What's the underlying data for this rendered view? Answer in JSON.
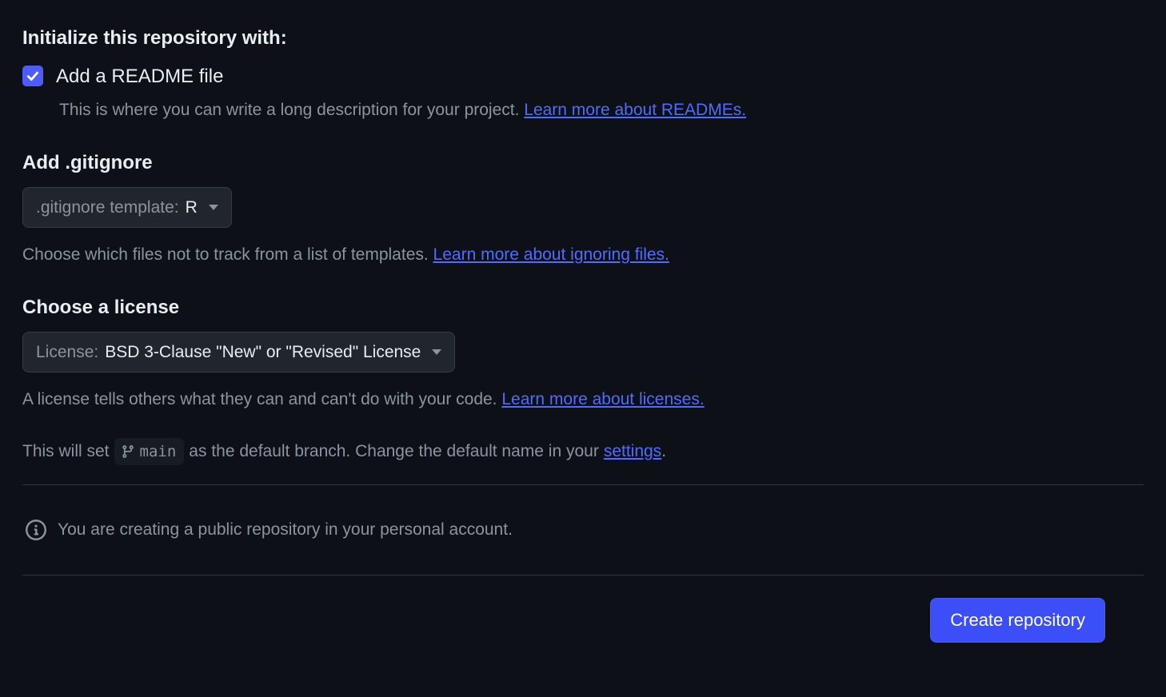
{
  "initialize": {
    "heading": "Initialize this repository with:",
    "readme": {
      "label": "Add a README file",
      "helper": "This is where you can write a long description for your project. ",
      "learn_more": "Learn more about READMEs."
    }
  },
  "gitignore": {
    "heading": "Add .gitignore",
    "dropdown_prefix": ".gitignore template:",
    "dropdown_value": "R",
    "helper": "Choose which files not to track from a list of templates. ",
    "learn_more": "Learn more about ignoring files."
  },
  "license": {
    "heading": "Choose a license",
    "dropdown_prefix": "License:",
    "dropdown_value": "BSD 3-Clause \"New\" or \"Revised\" License",
    "helper": "A license tells others what they can and can't do with your code. ",
    "learn_more": "Learn more about licenses."
  },
  "branch": {
    "prefix": "This will set",
    "name": "main",
    "middle": "as the default branch. Change the default name in your",
    "settings_link": "settings",
    "suffix": "."
  },
  "info": {
    "text": "You are creating a public repository in your personal account."
  },
  "actions": {
    "create": "Create repository"
  }
}
